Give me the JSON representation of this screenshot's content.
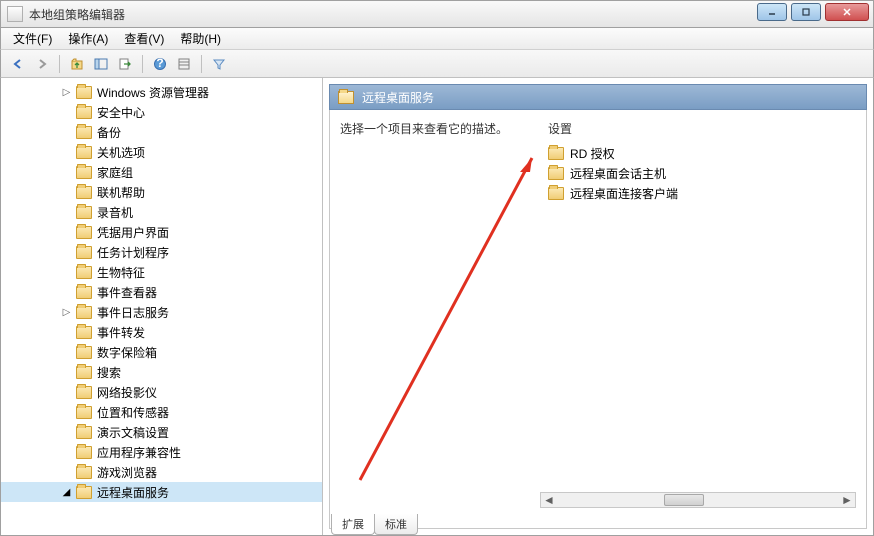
{
  "window": {
    "title": "本地组策略编辑器"
  },
  "menu": {
    "file": "文件(F)",
    "action": "操作(A)",
    "view": "查看(V)",
    "help": "帮助(H)"
  },
  "tree": {
    "items": [
      {
        "label": "Windows 资源管理器",
        "expander": "▷"
      },
      {
        "label": "安全中心",
        "expander": ""
      },
      {
        "label": "备份",
        "expander": ""
      },
      {
        "label": "关机选项",
        "expander": ""
      },
      {
        "label": "家庭组",
        "expander": ""
      },
      {
        "label": "联机帮助",
        "expander": ""
      },
      {
        "label": "录音机",
        "expander": ""
      },
      {
        "label": "凭据用户界面",
        "expander": ""
      },
      {
        "label": "任务计划程序",
        "expander": ""
      },
      {
        "label": "生物特征",
        "expander": ""
      },
      {
        "label": "事件查看器",
        "expander": ""
      },
      {
        "label": "事件日志服务",
        "expander": "▷"
      },
      {
        "label": "事件转发",
        "expander": ""
      },
      {
        "label": "数字保险箱",
        "expander": ""
      },
      {
        "label": "搜索",
        "expander": ""
      },
      {
        "label": "网络投影仪",
        "expander": ""
      },
      {
        "label": "位置和传感器",
        "expander": ""
      },
      {
        "label": "演示文稿设置",
        "expander": ""
      },
      {
        "label": "应用程序兼容性",
        "expander": ""
      },
      {
        "label": "游戏浏览器",
        "expander": ""
      },
      {
        "label": "远程桌面服务",
        "expander": "◢",
        "selected": true
      }
    ]
  },
  "details": {
    "header": "远程桌面服务",
    "description": "选择一个项目来查看它的描述。",
    "column_header": "设置",
    "items": [
      {
        "label": "RD 授权"
      },
      {
        "label": "远程桌面会话主机"
      },
      {
        "label": "远程桌面连接客户端"
      }
    ]
  },
  "tabs": {
    "extended": "扩展",
    "standard": "标准"
  }
}
